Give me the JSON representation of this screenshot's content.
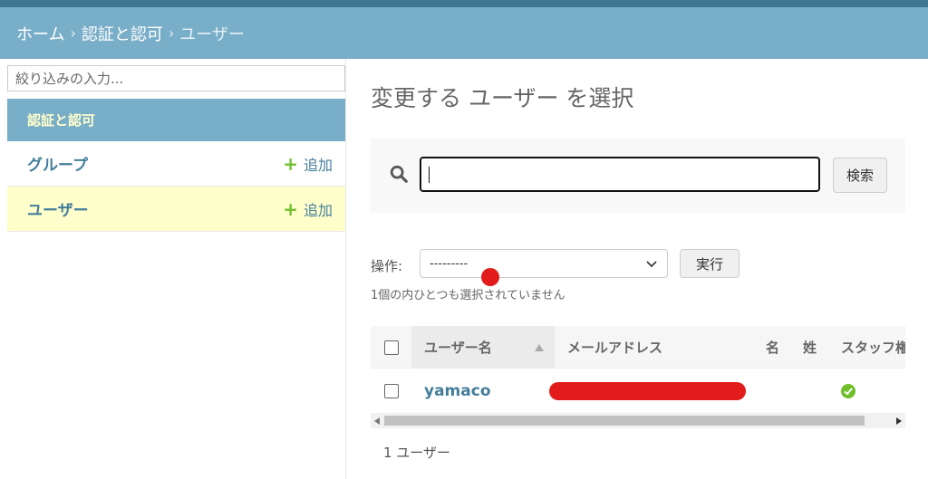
{
  "breadcrumbs": {
    "home": "ホーム",
    "sep": "›",
    "app": "認証と認可",
    "current": "ユーザー"
  },
  "sidebar": {
    "filter_placeholder": "絞り込みの入力...",
    "module_caption": "認証と認可",
    "items": [
      {
        "label": "グループ",
        "add_label": "追加",
        "selected": false
      },
      {
        "label": "ユーザー",
        "add_label": "追加",
        "selected": true
      }
    ]
  },
  "main": {
    "title": "変更する ユーザー を選択",
    "search": {
      "value": "",
      "button_label": "検索"
    },
    "actions": {
      "label": "操作:",
      "selected_option": "---------",
      "run_label": "実行",
      "selection_note": "1個の内ひとつも選択されていません"
    },
    "table": {
      "columns": [
        "ユーザー名",
        "メールアドレス",
        "名",
        "姓",
        "スタッフ権"
      ],
      "rows": [
        {
          "username": "yamaco",
          "email": "",
          "first_name": "",
          "last_name": "",
          "staff": true
        }
      ]
    },
    "paginator": "1 ユーザー"
  },
  "colors": {
    "header_dark": "#417690",
    "header_light": "#79aec8",
    "link": "#447e9b",
    "caption_text": "#ffffcc",
    "selected_row": "#ffffcc",
    "add_icon": "#70bf2b",
    "redaction": "#e21b1b",
    "check": "#70bf2b"
  },
  "icons": [
    "search-icon",
    "plus-icon",
    "chevron-down-icon",
    "sort-ascending-icon",
    "check-circle-icon"
  ]
}
